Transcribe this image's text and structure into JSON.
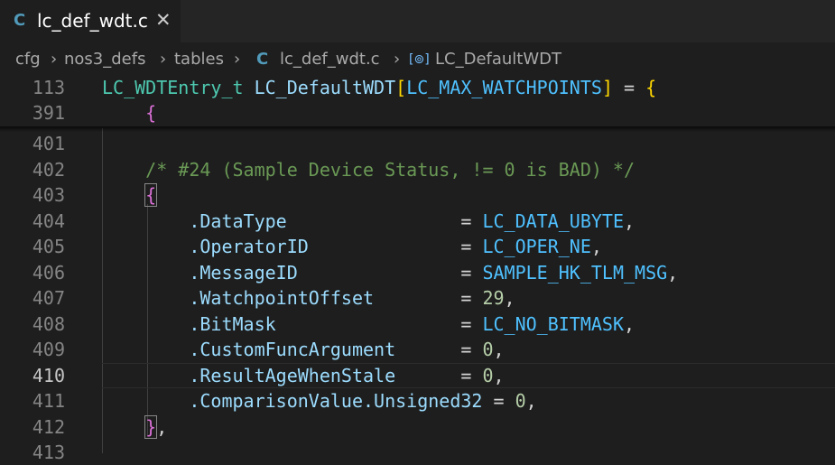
{
  "tab": {
    "icon": "C",
    "filename": "lc_def_wdt.c",
    "close": "✕"
  },
  "breadcrumb": {
    "items": [
      "cfg",
      "nos3_defs",
      "tables"
    ],
    "file_icon": "C",
    "file": "lc_def_wdt.c",
    "symbol_icon": "[⊚]",
    "symbol": "LC_DefaultWDT",
    "separator": "›"
  },
  "sticky": [
    {
      "ln": "113",
      "type": "LC_WDTEntry_t",
      "name": "LC_DefaultWDT",
      "bopen": "[",
      "size": "LC_MAX_WATCHPOINTS",
      "bclose": "]",
      "rest": " = ",
      "brace": "{"
    },
    {
      "ln": "391",
      "brace": "{"
    }
  ],
  "lines": [
    {
      "ln": "401"
    },
    {
      "ln": "402",
      "comment": "/* #24 (Sample Device Status, != 0 is BAD) */"
    },
    {
      "ln": "403",
      "brace": "{"
    },
    {
      "ln": "404",
      "field": ".DataType",
      "eq": "=",
      "value": "LC_DATA_UBYTE",
      "tail": ","
    },
    {
      "ln": "405",
      "field": ".OperatorID",
      "eq": "=",
      "value": "LC_OPER_NE",
      "tail": ","
    },
    {
      "ln": "406",
      "field": ".MessageID",
      "eq": "=",
      "value": "SAMPLE_HK_TLM_MSG",
      "tail": ","
    },
    {
      "ln": "407",
      "field": ".WatchpointOffset",
      "eq": "=",
      "value": "29",
      "tail": ","
    },
    {
      "ln": "408",
      "field": ".BitMask",
      "eq": "=",
      "value": "LC_NO_BITMASK",
      "tail": ","
    },
    {
      "ln": "409",
      "field": ".CustomFuncArgument",
      "eq": "=",
      "value": "0",
      "tail": ","
    },
    {
      "ln": "410",
      "field": ".ResultAgeWhenStale",
      "eq": "=",
      "value": "0",
      "tail": ","
    },
    {
      "ln": "411",
      "field": ".ComparisonValue.Unsigned32",
      "eq": "=",
      "value": "0",
      "tail": ","
    },
    {
      "ln": "412",
      "brace": "}",
      "tail": ","
    },
    {
      "ln": "413"
    }
  ],
  "colors": {
    "background": "#1e1e1e",
    "type": "#4ec9b0",
    "constant": "#4fc1ff",
    "comment": "#6a9955",
    "number": "#b5cea8"
  }
}
